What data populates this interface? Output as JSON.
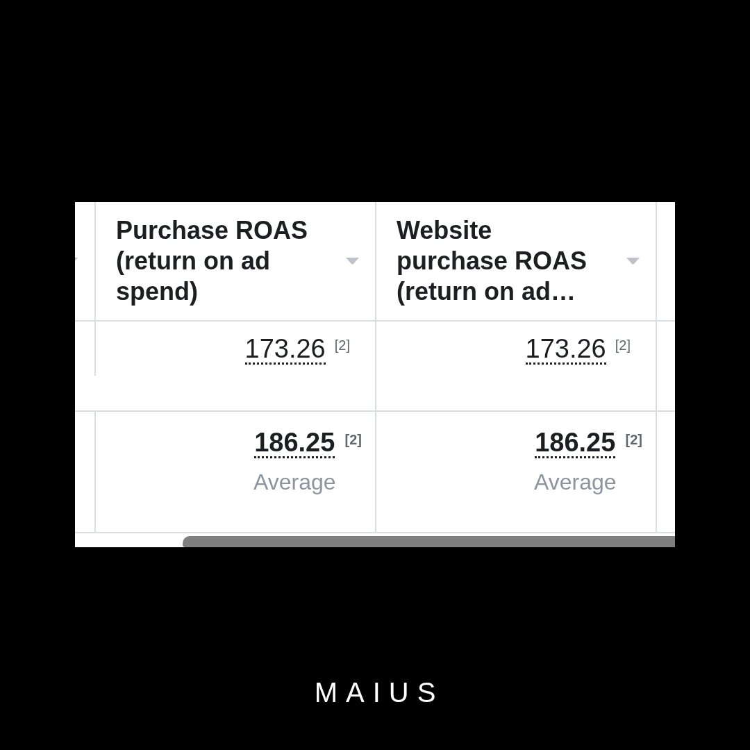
{
  "table": {
    "columns": [
      {
        "label": "Purchase ROAS (return on ad spend)"
      },
      {
        "label": "Website purchase ROAS (return on ad…"
      }
    ],
    "rows": [
      {
        "kind": "data",
        "cells": [
          {
            "value": "173.26",
            "note": "[2]"
          },
          {
            "value": "173.26",
            "note": "[2]"
          }
        ]
      },
      {
        "kind": "summary",
        "cells": [
          {
            "value": "186.25",
            "note": "[2]",
            "caption": "Average"
          },
          {
            "value": "186.25",
            "note": "[2]",
            "caption": "Average"
          }
        ]
      }
    ]
  },
  "logo": "MAIUS"
}
